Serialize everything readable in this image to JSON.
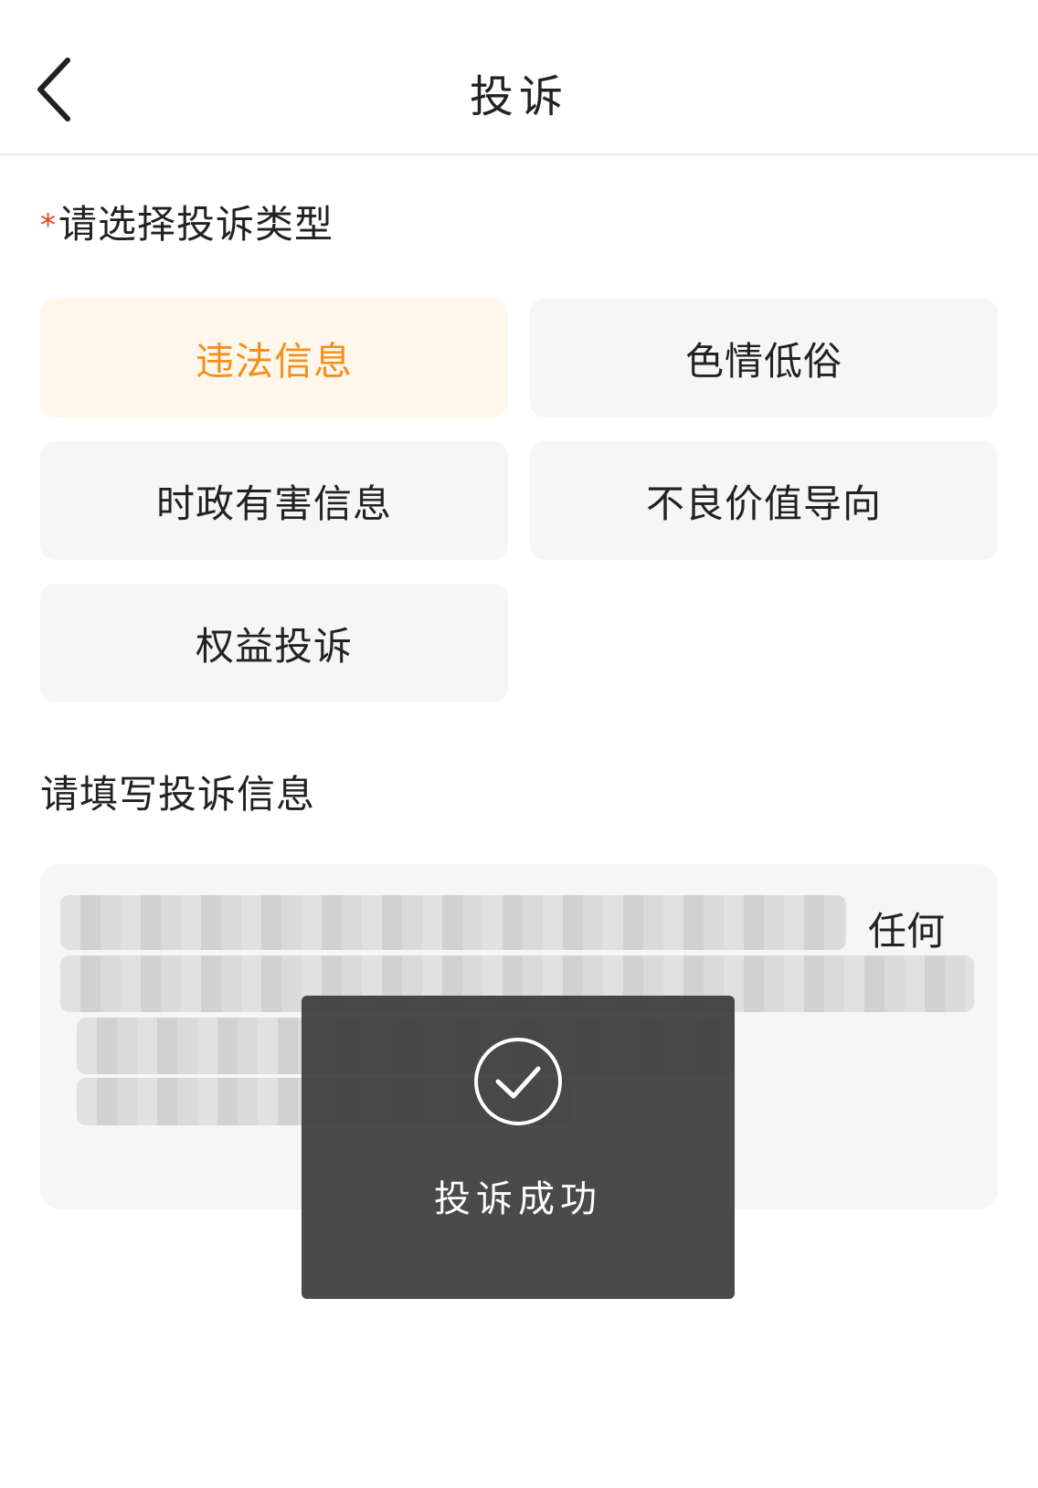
{
  "header": {
    "title": "投诉"
  },
  "complaint_type": {
    "required_marker": "*",
    "title": "请选择投诉类型",
    "options": [
      {
        "label": "违法信息",
        "selected": true
      },
      {
        "label": "色情低俗",
        "selected": false
      },
      {
        "label": "时政有害信息",
        "selected": false
      },
      {
        "label": "不良价值导向",
        "selected": false
      },
      {
        "label": "权益投诉",
        "selected": false
      }
    ],
    "selected_color": "#f5901d"
  },
  "complaint_info": {
    "title": "请填写投诉信息",
    "visible_text_tail": "任何"
  },
  "toast": {
    "icon": "check-circle-icon",
    "message": "投诉成功"
  }
}
